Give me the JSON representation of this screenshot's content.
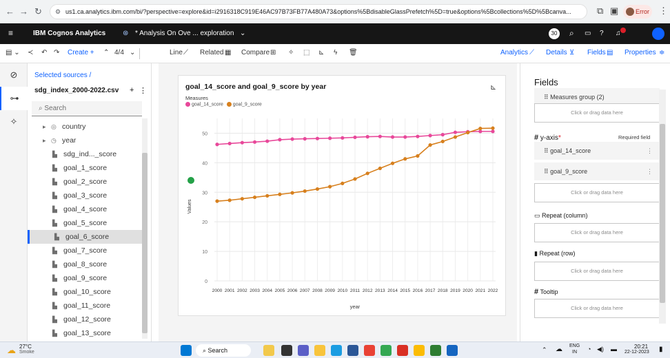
{
  "browser": {
    "url": "us1.ca.analytics.ibm.com/bi/?perspective=explore&id=i2916318C919E46AC97B73FB77A480A73&options%5BdisableGlassPrefetch%5D=true&options%5Bcollections%5D%5Bcanva...",
    "profile_label": "Error"
  },
  "app": {
    "brand": "IBM Cognos Analytics",
    "title": "* Analysis On Ove ... exploration",
    "user_initials": "30"
  },
  "toolbar": {
    "create": "Create +",
    "page_count": "4/4",
    "line": "Line",
    "related": "Related",
    "compare": "Compare",
    "tabs": [
      "Analytics",
      "Details",
      "Fields",
      "Properties"
    ]
  },
  "sources": {
    "breadcrumb": "Selected sources /",
    "file": "sdg_index_2000-2022.csv",
    "search_placeholder": "Search",
    "items": [
      {
        "label": "country",
        "icon": "location-icon",
        "kind": "group"
      },
      {
        "label": "year",
        "icon": "clock-icon",
        "kind": "group"
      },
      {
        "label": "sdg_ind..._score",
        "icon": "measure-icon",
        "kind": "measure"
      },
      {
        "label": "goal_1_score",
        "icon": "measure-icon",
        "kind": "measure"
      },
      {
        "label": "goal_2_score",
        "icon": "measure-icon",
        "kind": "measure"
      },
      {
        "label": "goal_3_score",
        "icon": "measure-icon",
        "kind": "measure"
      },
      {
        "label": "goal_4_score",
        "icon": "measure-icon",
        "kind": "measure"
      },
      {
        "label": "goal_5_score",
        "icon": "measure-icon",
        "kind": "measure"
      },
      {
        "label": "goal_6_score",
        "icon": "measure-icon",
        "kind": "measure"
      },
      {
        "label": "goal_7_score",
        "icon": "measure-icon",
        "kind": "measure"
      },
      {
        "label": "goal_8_score",
        "icon": "measure-icon",
        "kind": "measure"
      },
      {
        "label": "goal_9_score",
        "icon": "measure-icon",
        "kind": "measure"
      },
      {
        "label": "goal_10_score",
        "icon": "measure-icon",
        "kind": "measure"
      },
      {
        "label": "goal_11_score",
        "icon": "measure-icon",
        "kind": "measure"
      },
      {
        "label": "goal_12_score",
        "icon": "measure-icon",
        "kind": "measure"
      },
      {
        "label": "goal_13_score",
        "icon": "measure-icon",
        "kind": "measure"
      }
    ],
    "selected_index": 8
  },
  "fields_panel": {
    "title": "Fields",
    "measures_group": "Measures group (2)",
    "drop_hint": "Click or drag data here",
    "yaxis_label": "y-axis",
    "required": "Required field",
    "yaxis_items": [
      "goal_14_score",
      "goal_9_score"
    ],
    "repeat_column": "Repeat (column)",
    "repeat_row": "Repeat (row)",
    "tooltip": "Tooltip"
  },
  "chart_data": {
    "type": "line",
    "title": "goal_14_score and goal_9_score by year",
    "legend_title": "Measures",
    "legend_position": "top-left",
    "xlabel": "year",
    "ylabel": "Values",
    "ylim": [
      0,
      55
    ],
    "yticks": [
      0,
      10,
      20,
      30,
      40,
      50
    ],
    "grid": true,
    "x": [
      "2000",
      "2001",
      "2002",
      "2003",
      "2004",
      "2005",
      "2006",
      "2007",
      "2008",
      "2009",
      "2010",
      "2011",
      "2012",
      "2013",
      "2014",
      "2015",
      "2016",
      "2017",
      "2018",
      "2019",
      "2020",
      "2021",
      "2022"
    ],
    "series": [
      {
        "name": "goal_14_score",
        "color": "#e8489a",
        "values": [
          46.2,
          46.5,
          46.8,
          47.0,
          47.3,
          47.8,
          48.0,
          48.1,
          48.2,
          48.3,
          48.4,
          48.6,
          48.8,
          48.9,
          48.7,
          48.7,
          48.9,
          49.2,
          49.5,
          50.3,
          50.5,
          50.6,
          50.6
        ]
      },
      {
        "name": "goal_9_score",
        "color": "#d7801e",
        "values": [
          27.0,
          27.3,
          27.8,
          28.3,
          28.8,
          29.3,
          29.8,
          30.4,
          31.1,
          31.9,
          33.0,
          34.5,
          36.4,
          38.1,
          39.8,
          41.3,
          42.3,
          46.0,
          47.2,
          48.7,
          50.2,
          51.6,
          51.7
        ]
      }
    ]
  },
  "taskbar": {
    "weather_temp": "27°C",
    "weather_desc": "Smoke",
    "search": "Search",
    "lang": "ENG",
    "region": "IN",
    "time": "20:21",
    "date": "22-12-2023"
  }
}
